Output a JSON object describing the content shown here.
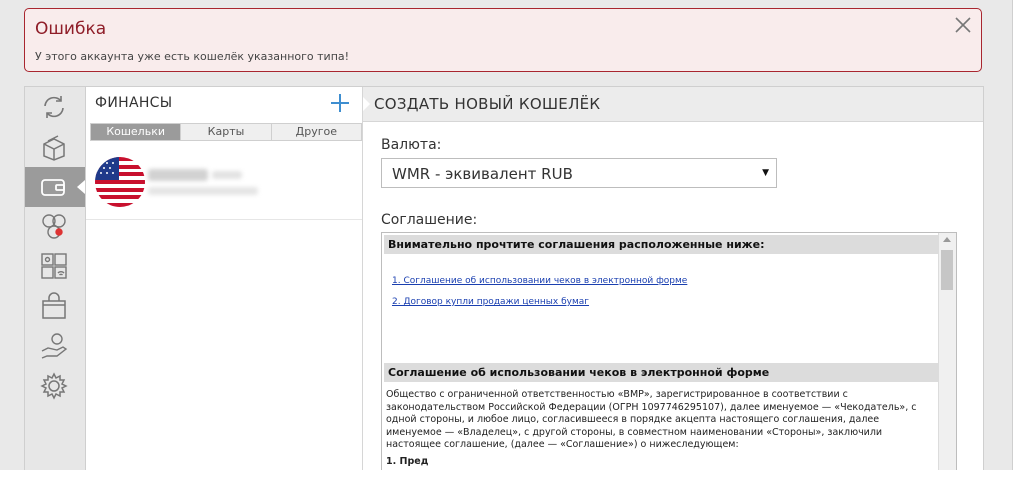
{
  "error": {
    "title": "Ошибка",
    "message": "У этого аккаунта уже есть кошелёк указанного типа!"
  },
  "icons": [
    "sync-icon",
    "box-icon",
    "wallet-icon",
    "people-icon",
    "phone-icon",
    "shopping-bag-icon",
    "hand-coin-icon",
    "settings-icon"
  ],
  "finances": {
    "title": "ФИНАНСЫ",
    "tabs": [
      {
        "label": "Кошельки",
        "selected": true
      },
      {
        "label": "Карты",
        "selected": false
      },
      {
        "label": "Другое",
        "selected": false
      }
    ]
  },
  "create": {
    "title": "СОЗДАТЬ НОВЫЙ КОШЕЛЁК",
    "currency_label": "Валюта:",
    "currency_value": "WMR - эквивалент RUB",
    "agreement_label": "Соглашение:",
    "agreement": {
      "header": "Внимательно прочтите соглашения расположенные ниже:",
      "links": [
        "1. Соглашение об использовании чеков в электронной форме",
        "2. Договор купли продажи ценных бумаг"
      ],
      "section_title": "Соглашение об использовании чеков в электронной форме",
      "paragraph": "Общество с ограниченной ответственностью «ВМР», зарегистрированное в соответствии с законодательством Российской Федерации (ОГРН 1097746295107), далее именуемое — «Чекодатель», с одной стороны, и любое лицо, согласившееся в порядке акцепта настоящего соглашения, далее именуемое — «Владелец», с другой стороны, в совместном наименовании «Стороны», заключили настоящее соглашение, (далее — «Соглашение») о нижеследующем:",
      "next_heading": "1. Пред"
    }
  },
  "colors": {
    "error_border": "#a8262f",
    "error_title": "#8f1d28",
    "plus_accent": "#3e8ed0",
    "link": "#1a3fb0"
  }
}
